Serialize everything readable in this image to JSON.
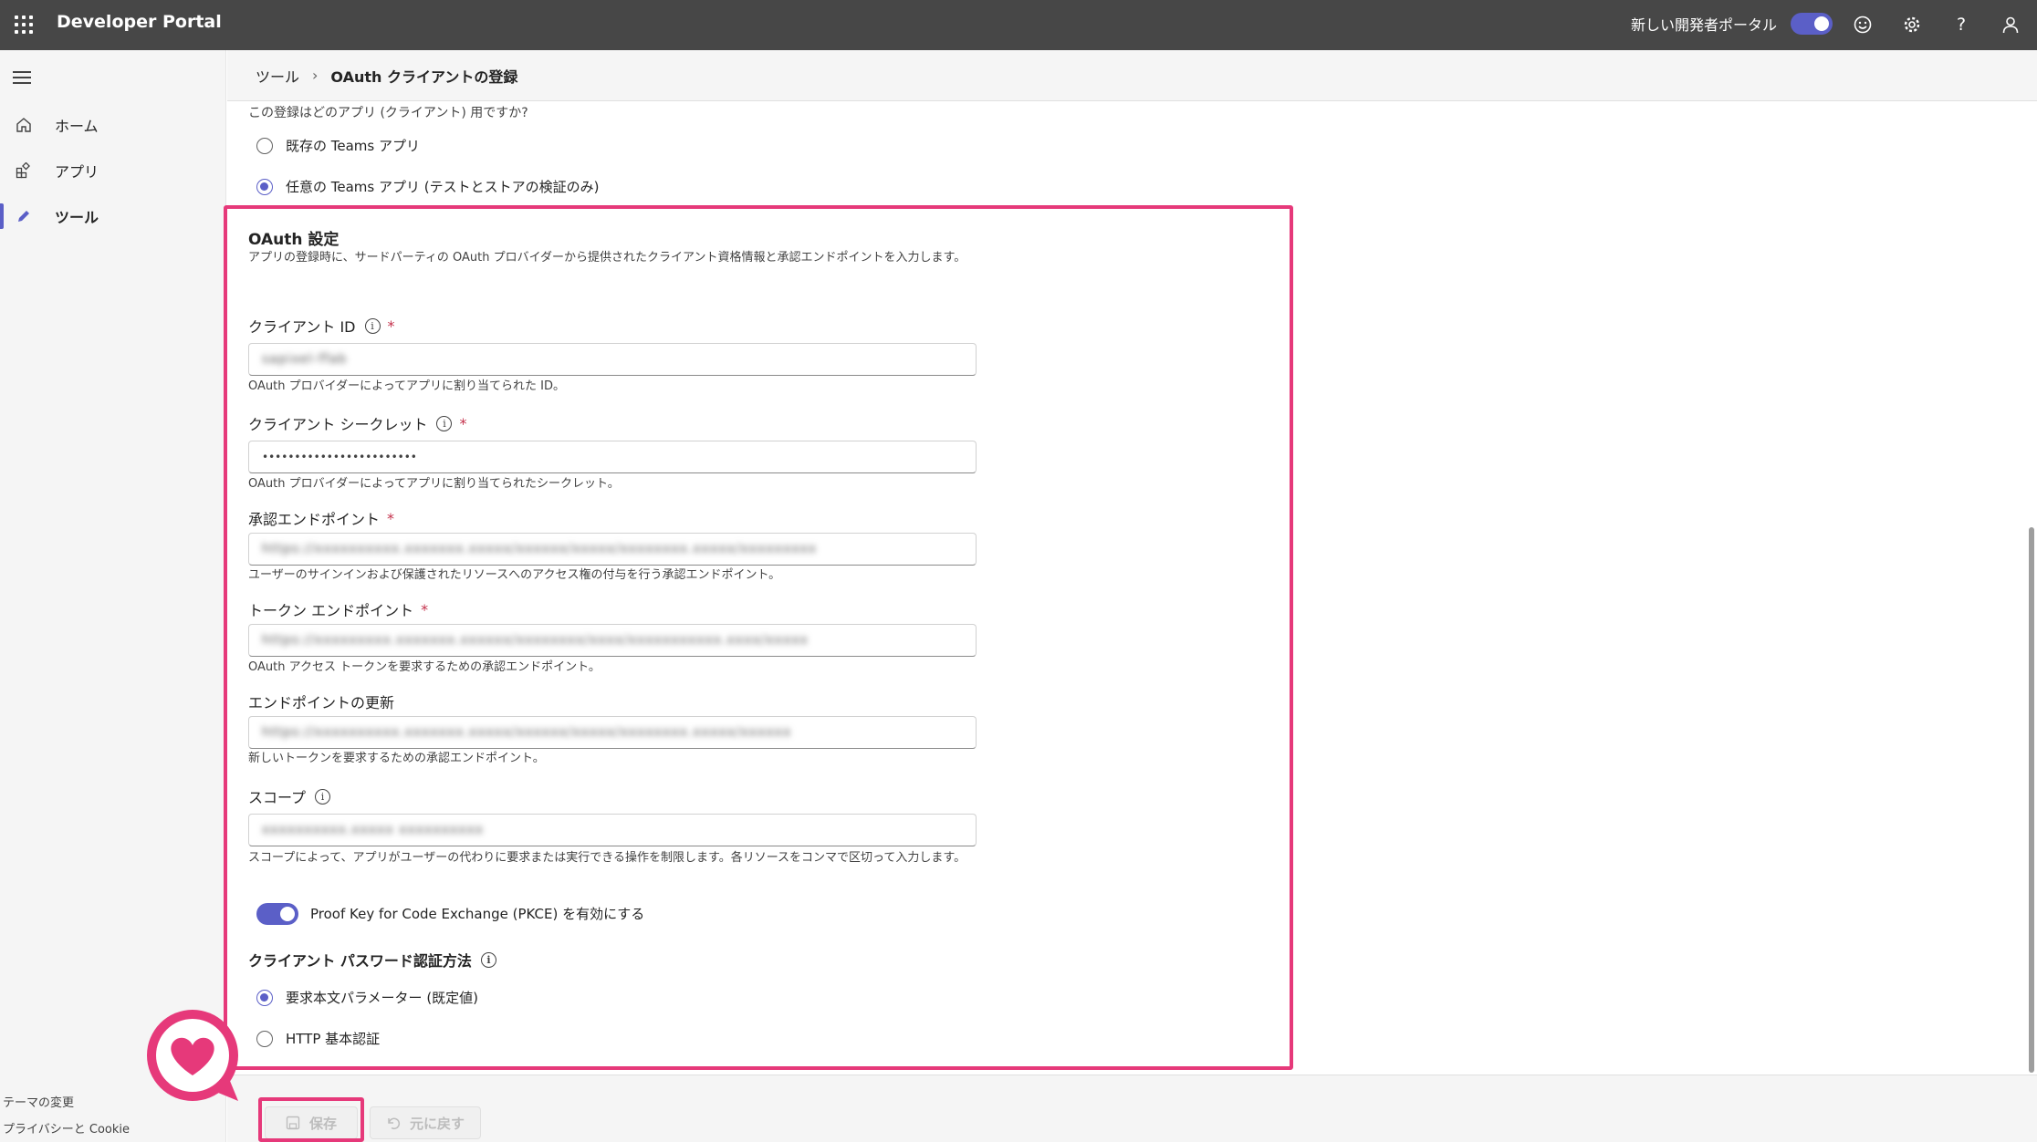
{
  "topbar": {
    "brand": "Developer Portal",
    "new_portal_label": "新しい開発者ポータル",
    "toggle_on": true
  },
  "sidebar": {
    "items": [
      {
        "label": "ホーム",
        "icon": "home-icon"
      },
      {
        "label": "アプリ",
        "icon": "apps-icon"
      },
      {
        "label": "ツール",
        "icon": "pencil-icon",
        "active": true
      }
    ],
    "footer": {
      "theme": "テーマの変更",
      "privacy": "プライバシーと Cookie"
    }
  },
  "breadcrumb": {
    "parent": "ツール",
    "separator": "›",
    "current": "OAuth クライアントの登録"
  },
  "app_question": {
    "prompt": "この登録はどのアプリ (クライアント) 用ですか?",
    "options": [
      {
        "label": "既存の Teams アプリ",
        "checked": false
      },
      {
        "label": "任意の Teams アプリ (テストとストアの検証のみ)",
        "checked": true
      }
    ]
  },
  "oauth": {
    "title": "OAuth 設定",
    "description": "アプリの登録時に、サードパーティの OAuth プロバイダーから提供されたクライアント資格情報と承認エンドポイントを入力します。",
    "client_id": {
      "label": "クライアント ID",
      "required": "*",
      "value": "sapixel-ffab",
      "help": "OAuth プロバイダーによってアプリに割り当てられた ID。"
    },
    "client_secret": {
      "label": "クライアント シークレット",
      "required": "*",
      "value": "••••••••••••••••••••••••",
      "help": "OAuth プロバイダーによってアプリに割り当てられたシークレット。"
    },
    "auth_endpoint": {
      "label": "承認エンドポイント",
      "required": "*",
      "value": "https://xxxxxxxxxx.xxxxxxx.xxxxx/xxxxxx/xxxxx/xxxxxxxx.xxxxx/xxxxxxxxx",
      "help": "ユーザーのサインインおよび保護されたリソースへのアクセス権の付与を行う承認エンドポイント。"
    },
    "token_endpoint": {
      "label": "トークン エンドポイント",
      "required": "*",
      "value": "https://xxxxxxxxx.xxxxxxx.xxxxxx/xxxxxxxx/xxxx/xxxxxxxxxxx.xxxx/xxxxx",
      "help": "OAuth アクセス トークンを要求するための承認エンドポイント。"
    },
    "refresh_endpoint": {
      "label": "エンドポイントの更新",
      "value": "https://xxxxxxxxxx.xxxxxxx.xxxxx/xxxxxx/xxxxx/xxxxxxxx.xxxxx/xxxxxx",
      "help": "新しいトークンを要求するための承認エンドポイント。"
    },
    "scope": {
      "label": "スコープ",
      "value": "xxxxxxxxxx.xxxxx  xxxxxxxxxx",
      "help": "スコープによって、アプリがユーザーの代わりに要求または実行できる操作を制限します。各リソースをコンマで区切って入力します。"
    },
    "pkce": {
      "label": "Proof Key for Code Exchange (PKCE) を有効にする",
      "enabled": true
    },
    "client_auth": {
      "title": "クライアント パスワード認証方法",
      "options": [
        {
          "label": "要求本文パラメーター (既定値)",
          "checked": true
        },
        {
          "label": "HTTP 基本認証",
          "checked": false
        }
      ]
    }
  },
  "footer": {
    "save_label": "保存",
    "revert_label": "元に戻す"
  },
  "colors": {
    "accent": "#5b5fc7",
    "highlight": "#e6397a",
    "topbar": "#474747"
  }
}
